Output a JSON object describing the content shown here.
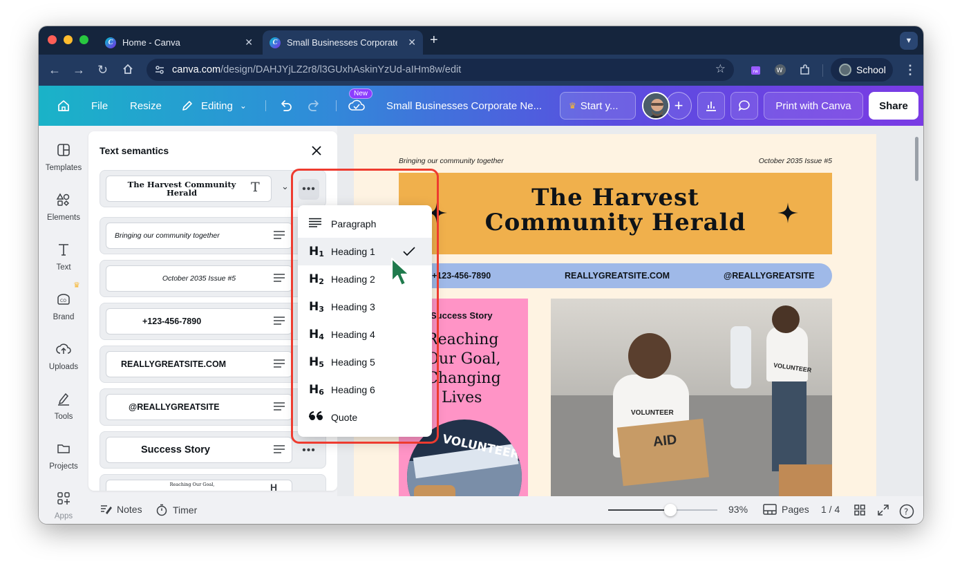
{
  "browser": {
    "tabs": [
      {
        "label": "Home - Canva"
      },
      {
        "label": "Small Businesses Corporate N"
      }
    ],
    "url_host": "canva.com",
    "url_path": "/design/DAHJYjLZ2r8/l3GUxhAskinYzUd-aIHm8w/edit",
    "profile_label": "School"
  },
  "header": {
    "file": "File",
    "resize": "Resize",
    "editing": "Editing",
    "new_badge": "New",
    "doc_title": "Small Businesses Corporate Ne...",
    "start_trial": "Start y...",
    "print": "Print with Canva",
    "share": "Share"
  },
  "rail": [
    {
      "label": "Templates"
    },
    {
      "label": "Elements"
    },
    {
      "label": "Text"
    },
    {
      "label": "Brand"
    },
    {
      "label": "Uploads"
    },
    {
      "label": "Tools"
    },
    {
      "label": "Projects"
    },
    {
      "label": "Apps"
    }
  ],
  "panel": {
    "title": "Text semantics",
    "rows": [
      {
        "text": "The Harvest Community Herald",
        "kind": "heading"
      },
      {
        "text": "Bringing our community together",
        "kind": "paragraph"
      },
      {
        "text": "October 2035 Issue #5",
        "kind": "paragraph"
      },
      {
        "text": "+123-456-7890",
        "kind": "paragraph"
      },
      {
        "text": "REALLYGREATSITE.COM",
        "kind": "paragraph"
      },
      {
        "text": "@REALLYGREATSITE",
        "kind": "paragraph"
      },
      {
        "text": "Success Story",
        "kind": "paragraph"
      },
      {
        "text": "Reaching Our Goal,",
        "kind": "heading"
      }
    ]
  },
  "dropdown": {
    "items": [
      {
        "label": "Paragraph",
        "icon": "paragraph-icon"
      },
      {
        "label": "Heading 1",
        "icon": "H",
        "sub": "1",
        "selected": true
      },
      {
        "label": "Heading 2",
        "icon": "H",
        "sub": "2"
      },
      {
        "label": "Heading 3",
        "icon": "H",
        "sub": "3"
      },
      {
        "label": "Heading 4",
        "icon": "H",
        "sub": "4"
      },
      {
        "label": "Heading 5",
        "icon": "H",
        "sub": "5"
      },
      {
        "label": "Heading 6",
        "icon": "H",
        "sub": "6"
      },
      {
        "label": "Quote",
        "icon": "quote-icon"
      }
    ]
  },
  "document": {
    "tagline": "Bringing our community together",
    "issue": "October 2035 Issue #5",
    "title_line1": "The Harvest",
    "title_line2": "Community Herald",
    "phone": "+123-456-7890",
    "site": "REALLYGREATSITE.COM",
    "handle": "@REALLYGREATSITE",
    "story_label": "Success Story",
    "story_line1": "Reaching",
    "story_line2": "Our Goal,",
    "story_line3": "Changing",
    "story_line4": "Lives",
    "badge_text": "VOLUNTEER",
    "box_text": "AID",
    "shirt1": "VOLUNTEER",
    "shirt2": "VOLUNTEER"
  },
  "bottom": {
    "notes": "Notes",
    "timer": "Timer",
    "zoom": "93%",
    "pages": "Pages",
    "page_count": "1 / 4",
    "zoom_level": 0.57
  },
  "colors": {
    "brand_gradient_start": "#1ab3c8",
    "brand_gradient_end": "#7a3be4",
    "title_band": "#f0b04c",
    "contact_band": "#9fb9e8",
    "story_panel": "#ff94c6",
    "page_bg": "#fef3e2",
    "highlight": "#ee3b2f",
    "cursor": "#1f7a4c"
  }
}
